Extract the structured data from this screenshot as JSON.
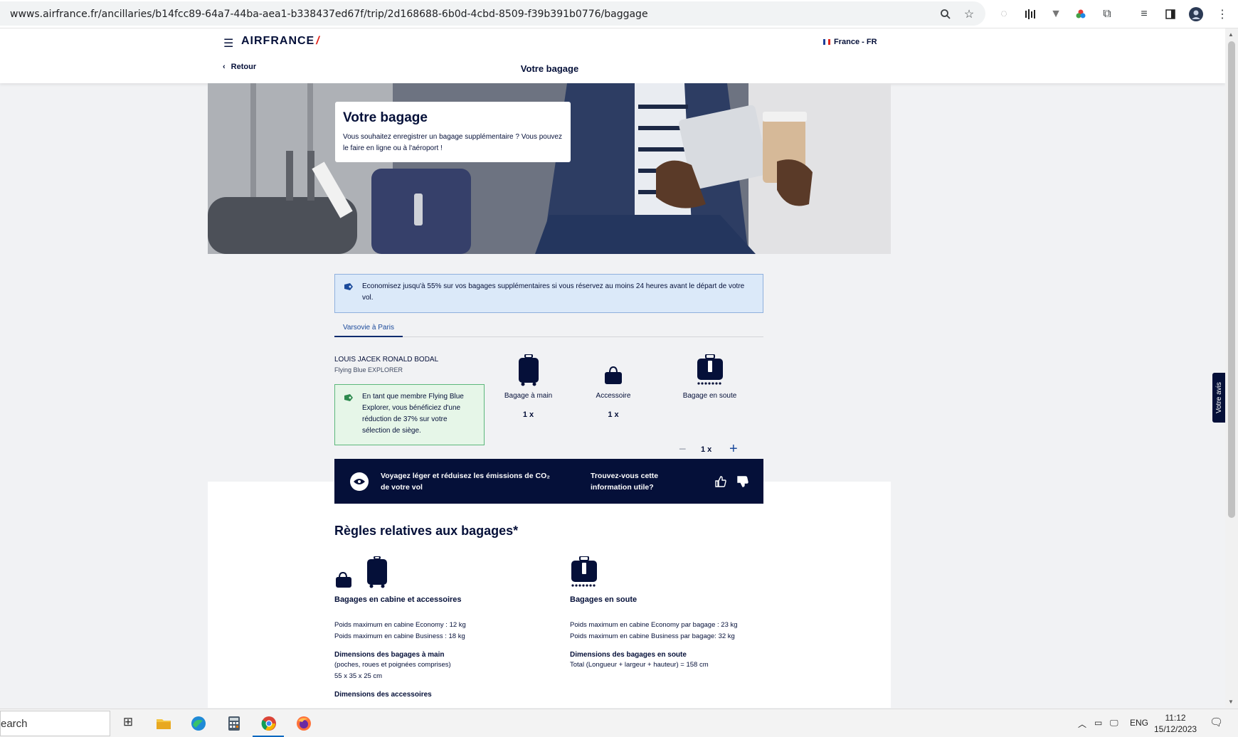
{
  "browser": {
    "url": "wwws.airfrance.fr/ancillaries/b14fcc89-64a7-44ba-aea1-b338437ed67f/trip/2d168688-6b0d-4cbd-8509-f39b391b0776/baggage"
  },
  "header": {
    "brand": "AIRFRANCE",
    "locale": "France - FR",
    "back_label": "Retour",
    "title": "Votre bagage"
  },
  "hero": {
    "title": "Votre bagage",
    "text": "Vous souhaitez enregistrer un bagage supplémentaire ? Vous pouvez le faire en ligne ou à l'aéroport !"
  },
  "promo": {
    "text": "Economisez jusqu'à 55% sur vos bagages supplémentaires si vous réservez au moins 24 heures avant le départ de votre vol."
  },
  "tabs": [
    {
      "label": "Varsovie à Paris"
    }
  ],
  "passenger": {
    "name": "LOUIS JACEK RONALD BODAL",
    "tier": "Flying Blue EXPLORER",
    "member_notice": "En tant que membre Flying Blue Explorer, vous bénéficiez d'une réduction de 37% sur votre sélection de siège."
  },
  "bags": [
    {
      "label": "Bagage à main",
      "qty": "1 x"
    },
    {
      "label": "Accessoire",
      "qty": "1 x"
    },
    {
      "label": "Bagage en soute",
      "qty": "1 x"
    }
  ],
  "banner": {
    "text": "Voyagez léger et réduisez les émissions de CO₂ de votre vol",
    "question": "Trouvez-vous cette information utile?"
  },
  "rules": {
    "title": "Règles relatives aux bagages*",
    "cabin": {
      "heading": "Bagages en cabine et accessoires",
      "line1": "Poids maximum en cabine Economy : 12 kg",
      "line2": "Poids maximum en cabine Business : 18 kg",
      "dims_heading": "Dimensions des bagages à main",
      "dims_note": "(poches, roues et poignées comprises)",
      "dims_value": "55 x 35 x 25 cm",
      "acc_heading": "Dimensions des accessoires"
    },
    "hold": {
      "heading": "Bagages en soute",
      "line1": "Poids maximum en cabine Economy par bagage : 23 kg",
      "line2": "Poids maximum en cabine Business par bagage: 32 kg",
      "dims_heading": "Dimensions des bagages en soute",
      "dims_value": "Total (Longueur + largeur + hauteur) = 158 cm"
    }
  },
  "feedback_tab": "Votre avis",
  "taskbar": {
    "search": "earch",
    "lang": "ENG",
    "time": "11:12",
    "date": "15/12/2023"
  },
  "colors": {
    "brand_navy": "#051039",
    "brand_red": "#e1251b",
    "promo_bg": "#dbe9f9",
    "member_bg": "#e6f6e8"
  }
}
